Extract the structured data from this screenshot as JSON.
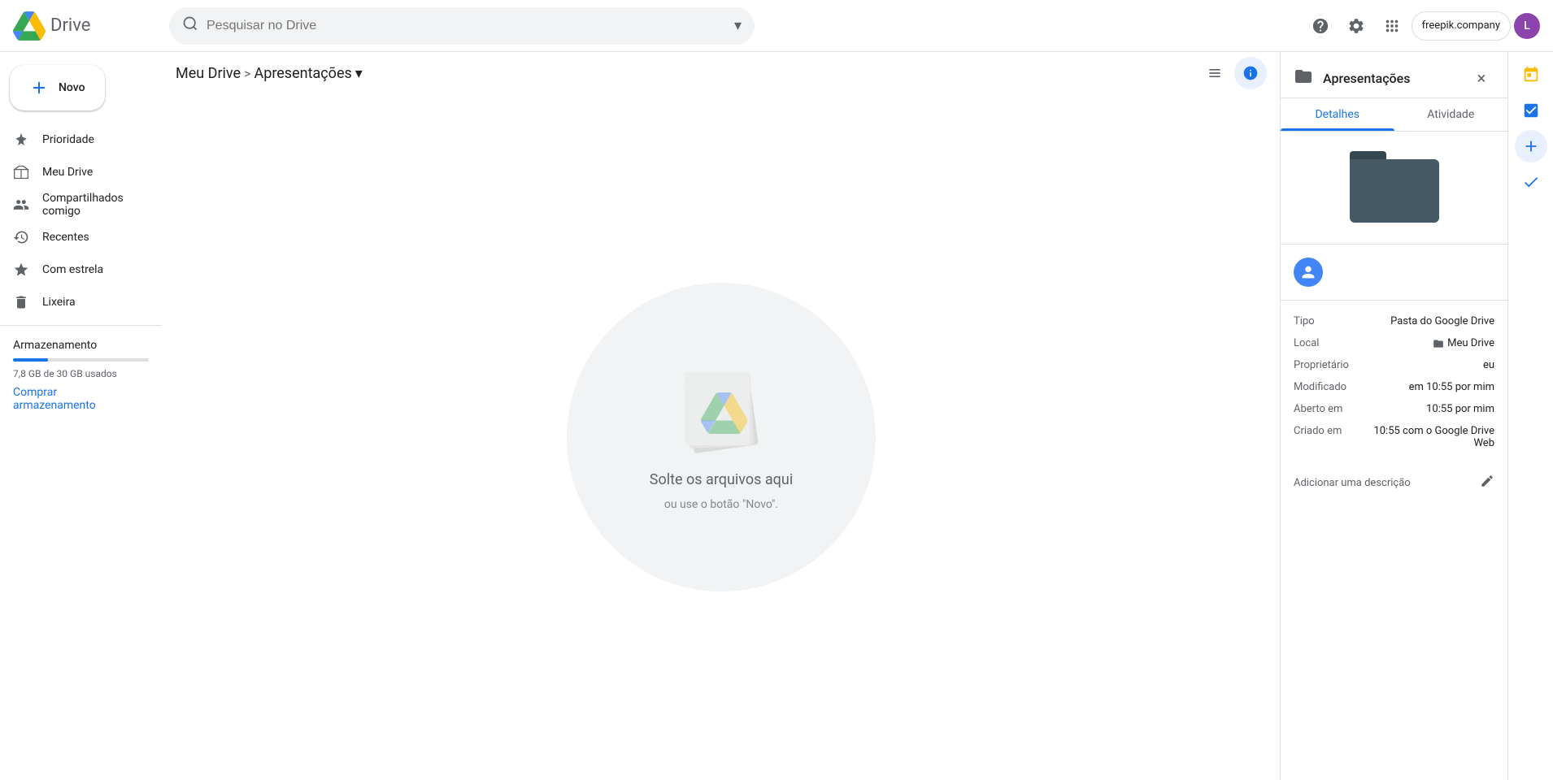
{
  "app": {
    "title": "Drive",
    "logo_alt": "Google Drive"
  },
  "topbar": {
    "search_placeholder": "Pesquisar no Drive",
    "help_icon": "?",
    "settings_icon": "⚙",
    "grid_icon": "⠿",
    "freepik_label": "freepik.company",
    "avatar_initials": "L"
  },
  "sidebar": {
    "new_button": "Novo",
    "nav_items": [
      {
        "id": "priority",
        "label": "Prioridade",
        "icon": "priority"
      },
      {
        "id": "my-drive",
        "label": "Meu Drive",
        "icon": "drive"
      },
      {
        "id": "shared",
        "label": "Compartilhados comigo",
        "icon": "shared"
      },
      {
        "id": "recent",
        "label": "Recentes",
        "icon": "recent"
      },
      {
        "id": "starred",
        "label": "Com estrela",
        "icon": "star"
      },
      {
        "id": "trash",
        "label": "Lixeira",
        "icon": "trash"
      }
    ],
    "storage": {
      "label": "Armazenamento",
      "used_text": "7,8 GB de 30 GB usados",
      "used_percent": 26,
      "buy_label": "Comprar\narmazenamento"
    }
  },
  "breadcrumb": {
    "root_label": "Meu Drive",
    "separator": ">",
    "current_label": "Apresentações",
    "dropdown_icon": "▾"
  },
  "dropzone": {
    "main_text": "Solte os arquivos aqui",
    "sub_text": "ou use o botão \"Novo\"."
  },
  "detail_panel": {
    "folder_icon": "📁",
    "title": "Apresentações",
    "close_icon": "×",
    "tabs": [
      {
        "id": "details",
        "label": "Detalhes",
        "active": true
      },
      {
        "id": "activity",
        "label": "Atividade",
        "active": false
      }
    ],
    "meta": {
      "tipo_label": "Tipo",
      "tipo_val": "Pasta do Google Drive",
      "local_label": "Local",
      "local_val": "Meu Drive",
      "proprietario_label": "Proprietário",
      "proprietario_val": "eu",
      "modificado_label": "Modificado",
      "modificado_val": "em 10:55 por mim",
      "aberto_label": "Aberto em",
      "aberto_val": "10:55 por mim",
      "criado_label": "Criado em",
      "criado_val": "10:55 com o Google Drive Web"
    },
    "description_label": "Adicionar uma descrição",
    "edit_icon": "✏"
  },
  "right_edge": {
    "calendar_icon": "📅",
    "tasks_icon": "✓",
    "plus_icon": "+",
    "check_icon": "✓"
  }
}
